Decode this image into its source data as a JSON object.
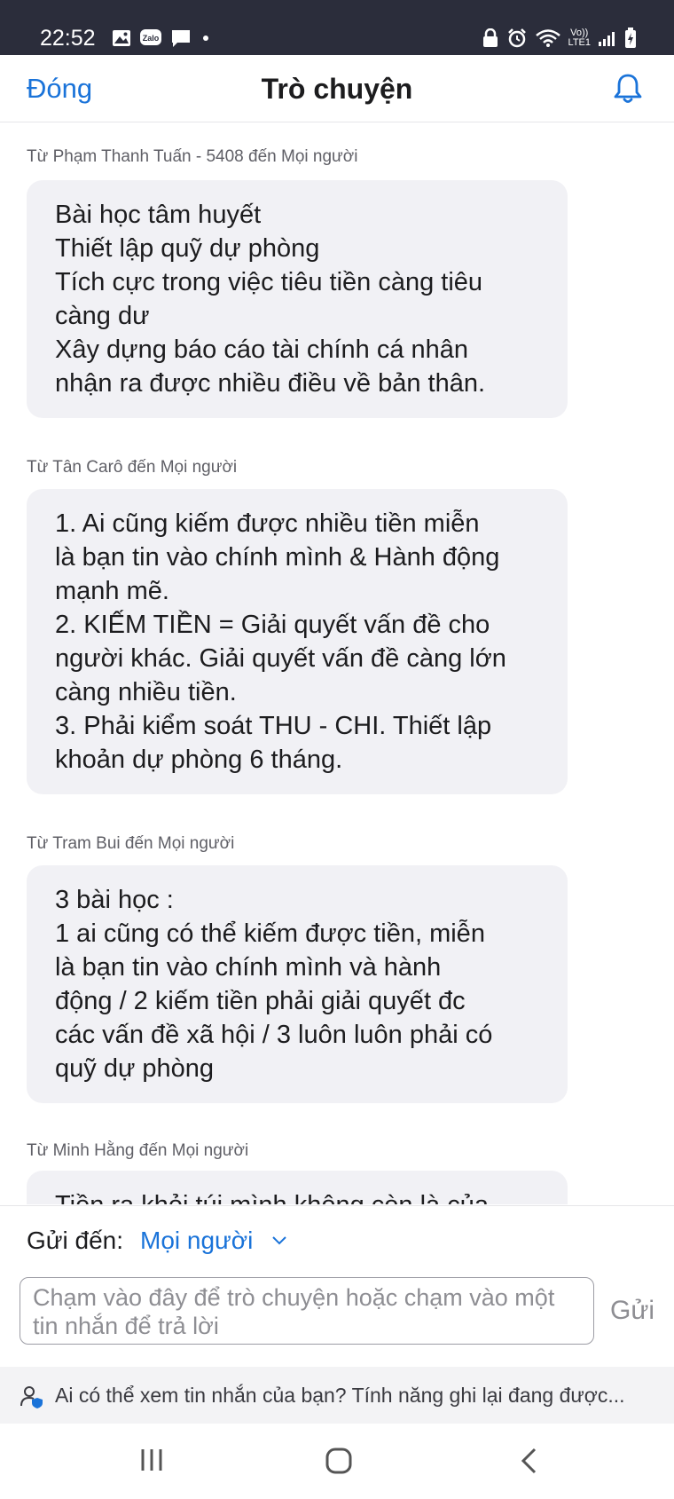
{
  "status_bar": {
    "time": "22:52",
    "left_icons": [
      "image-icon",
      "zalo-icon",
      "message-icon",
      "dot-icon"
    ],
    "zalo_label": "Zalo",
    "volte_label_top": "Vo))",
    "volte_label_bottom": "LTE1",
    "right_icons": [
      "lock-icon",
      "alarm-icon",
      "wifi-icon",
      "volte-icon",
      "signal-icon",
      "battery-icon"
    ]
  },
  "header": {
    "close_label": "Đóng",
    "title": "Trò chuyện",
    "bell_icon": "bell-icon"
  },
  "messages": [
    {
      "meta": "Từ Phạm Thanh Tuấn - 5408 đến Mọi người",
      "lines": [
        "Bài học tâm huyết",
        "Thiết lập quỹ dự phòng",
        "Tích cực trong việc tiêu tiền càng tiêu",
        "càng dư",
        "Xây dựng báo cáo tài chính cá nhân",
        "nhận ra được nhiều điều về bản thân."
      ]
    },
    {
      "meta": "Từ Tân Carô đến Mọi người",
      "lines": [
        "1. Ai cũng kiếm được nhiều tiền miễn",
        "là bạn tin vào chính mình & Hành động",
        "mạnh mẽ.",
        "2. KIẾM TIỀN = Giải quyết vấn đề cho",
        "người khác. Giải quyết vấn đề càng lớn",
        "càng nhiều tiền.",
        "3. Phải kiểm soát THU - CHI. Thiết lập",
        "khoản dự phòng 6 tháng."
      ]
    },
    {
      "meta": "Từ Tram Bui đến Mọi người",
      "lines": [
        "3 bài học :",
        "1 ai cũng có thể kiếm được tiền, miễn",
        "là bạn tin vào chính mình và hành",
        "động / 2 kiếm tiền phải giải quyết đc",
        "các vấn đề xã hội / 3 luôn luôn phải có",
        "quỹ dự phòng"
      ]
    },
    {
      "meta": "Từ Minh Hằng đến Mọi người",
      "lines": [
        "Tiền ra khỏi túi mình không còn là của"
      ]
    }
  ],
  "composer": {
    "send_to_label": "Gửi đến:",
    "send_to_value": "Mọi người",
    "input_placeholder": "Chạm vào đây để trò chuyện hoặc chạm vào một tin nhắn để trả lời",
    "send_label": "Gửi"
  },
  "notice": {
    "text": "Ai có thể xem tin nhắn của bạn? Tính năng ghi lại đang được..."
  },
  "nav": {
    "icons": [
      "recent-apps-icon",
      "home-icon",
      "back-icon"
    ]
  },
  "colors": {
    "accent": "#1a73d9",
    "status_bar": "#2b2d3b",
    "bubble": "#f1f1f5"
  }
}
